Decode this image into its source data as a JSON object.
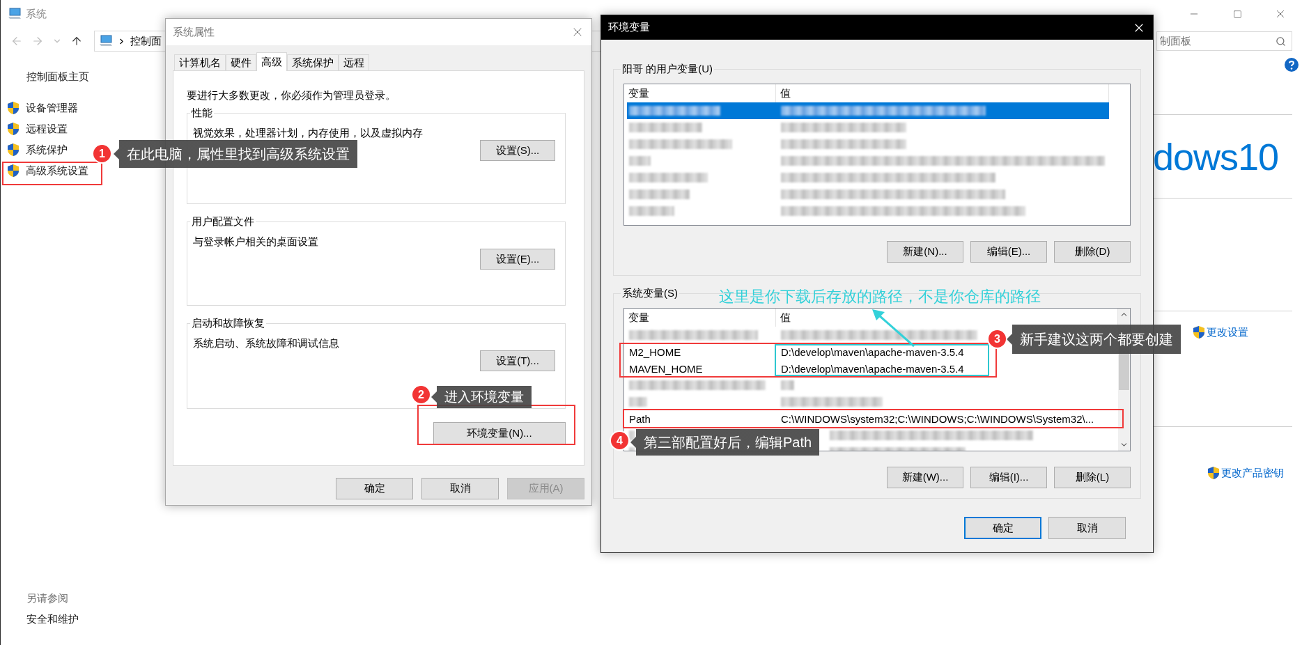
{
  "window": {
    "title": "系统",
    "address": "控制面",
    "search": "制面板"
  },
  "sidebar": {
    "home": "控制面板主页",
    "items": [
      {
        "label": "设备管理器"
      },
      {
        "label": "远程设置"
      },
      {
        "label": "系统保护"
      },
      {
        "label": "高级系统设置"
      }
    ],
    "see_also": "另请参阅",
    "links": [
      "安全和维护"
    ]
  },
  "content": {
    "logo_text": "dows10",
    "links": [
      "更改设置",
      "更改产品密钥"
    ]
  },
  "system_properties": {
    "title": "系统属性",
    "tabs": [
      {
        "label": "计算机名",
        "selected": false
      },
      {
        "label": "硬件",
        "selected": false
      },
      {
        "label": "高级",
        "selected": true
      },
      {
        "label": "系统保护",
        "selected": false
      },
      {
        "label": "远程",
        "selected": false
      }
    ],
    "notice": "要进行大多数更改，你必须作为管理员登录。",
    "groups": [
      {
        "title": "性能",
        "description": "视觉效果，处理器计划，内存使用，以及虚拟内存",
        "button": "设置(S)..."
      },
      {
        "title": "用户配置文件",
        "description": "与登录帐户相关的桌面设置",
        "button": "设置(E)..."
      },
      {
        "title": "启动和故障恢复",
        "description": "系统启动、系统故障和调试信息",
        "button": "设置(T)..."
      }
    ],
    "env_button": "环境变量(N)...",
    "buttons": [
      {
        "label": "确定",
        "disabled": false
      },
      {
        "label": "取消",
        "disabled": false
      },
      {
        "label": "应用(A)",
        "disabled": true
      }
    ]
  },
  "environment_variables": {
    "title": "环境变量",
    "user_group": {
      "title": "阳哥 的用户变量(U)",
      "columns": [
        "变量",
        "值"
      ],
      "rows": [
        {
          "kind": "redacted",
          "selected": true
        },
        {
          "kind": "redacted",
          "selected": false
        },
        {
          "kind": "redacted",
          "selected": false
        },
        {
          "kind": "redacted",
          "selected": false
        },
        {
          "kind": "redacted",
          "selected": false
        },
        {
          "kind": "redacted",
          "selected": false
        },
        {
          "kind": "redacted",
          "selected": false
        }
      ],
      "buttons": [
        "新建(N)...",
        "编辑(E)...",
        "删除(D)"
      ]
    },
    "system_group": {
      "title": "系统变量(S)",
      "columns": [
        "变量",
        "值"
      ],
      "rows": [
        {
          "kind": "redacted",
          "selected": false
        },
        {
          "kind": "text",
          "name": "M2_HOME",
          "value": "D:\\develop\\maven\\apache-maven-3.5.4",
          "selected": false
        },
        {
          "kind": "text",
          "name": "MAVEN_HOME",
          "value": "D:\\develop\\maven\\apache-maven-3.5.4",
          "selected": false
        },
        {
          "kind": "redacted",
          "selected": false
        },
        {
          "kind": "redacted",
          "selected": false
        },
        {
          "kind": "text",
          "name": "Path",
          "value": "C:\\WINDOWS\\system32;C:\\WINDOWS;C:\\WINDOWS\\System32\\...",
          "selected": false
        },
        {
          "kind": "redacted",
          "selected": false
        },
        {
          "kind": "redacted",
          "selected": false
        }
      ],
      "buttons": [
        "新建(W)...",
        "编辑(I)...",
        "删除(L)"
      ]
    },
    "buttons": [
      {
        "label": "确定",
        "default": true
      },
      {
        "label": "取消",
        "default": false
      }
    ]
  },
  "annotations": [
    {
      "number": "1",
      "text": "在此电脑，属性里找到高级系统设置"
    },
    {
      "number": "2",
      "text": "进入环境变量"
    },
    {
      "number": "3",
      "text": "新手建议这两个都要创建"
    },
    {
      "number": "4",
      "text": "第三部配置好后，编辑Path"
    }
  ],
  "note": {
    "text": "这里是你下载后存放的路径，不是你仓库的路径"
  }
}
